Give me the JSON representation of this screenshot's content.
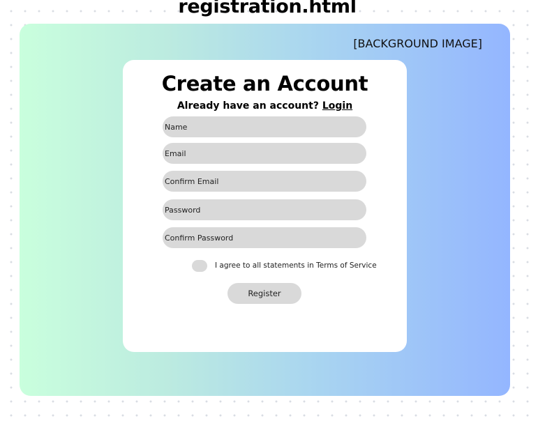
{
  "page": {
    "heading": "registration.html"
  },
  "background": {
    "label": "[BACKGROUND IMAGE]",
    "gradient_start": "#c9ffdd",
    "gradient_end": "#94b6ff"
  },
  "form": {
    "title": "Create an Account",
    "subtitle_text": "Already have an account?",
    "login_link": "Login",
    "fields": [
      {
        "placeholder": "Name"
      },
      {
        "placeholder": "Email"
      },
      {
        "placeholder": "Confirm Email"
      },
      {
        "placeholder": "Password"
      },
      {
        "placeholder": "Confirm Password"
      }
    ],
    "terms_label": "I agree to all statements in Terms of Service",
    "register_label": "Register"
  }
}
